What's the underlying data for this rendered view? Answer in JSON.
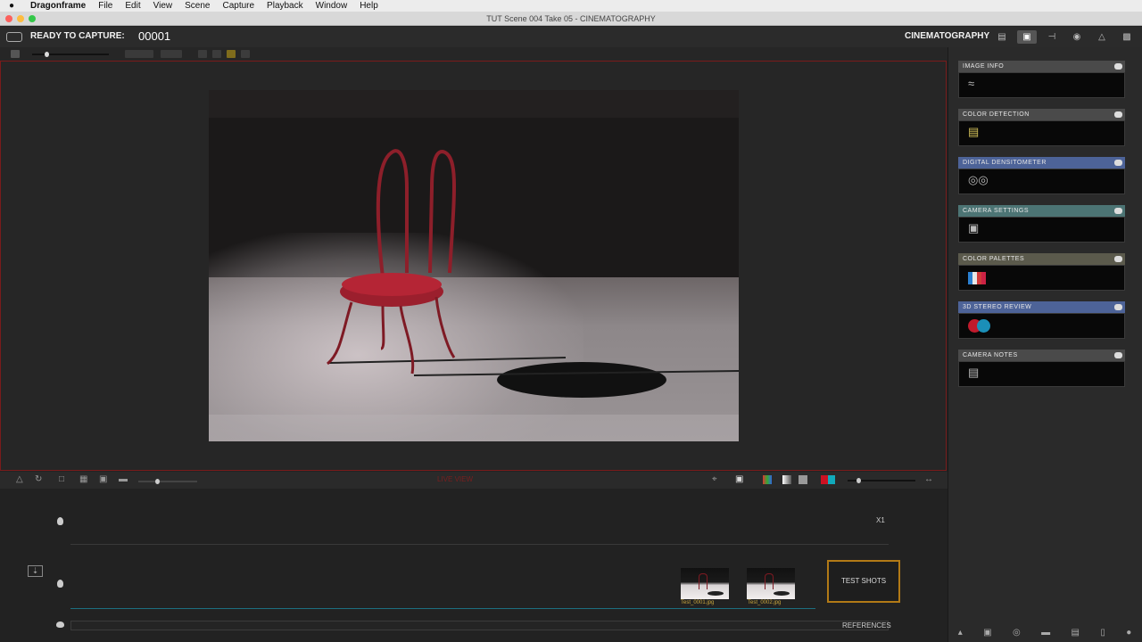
{
  "menubar": {
    "app": "Dragonframe",
    "items": [
      "File",
      "Edit",
      "View",
      "Scene",
      "Capture",
      "Playback",
      "Window",
      "Help"
    ]
  },
  "window": {
    "title": "TUT  Scene 004  Take 05 - CINEMATOGRAPHY"
  },
  "status": {
    "ready": "READY TO CAPTURE:",
    "frame": "00001",
    "workspace": "CINEMATOGRAPHY"
  },
  "viewbar": {
    "mode": "LIVE VIEW"
  },
  "timeline": {
    "speed": "X1",
    "thumbs": [
      {
        "caption": "Test_0001.jpg"
      },
      {
        "caption": "Test_0002.jpg"
      }
    ],
    "test_shots": "TEST SHOTS",
    "references": "REFERENCES"
  },
  "widgets": [
    {
      "title": "IMAGE INFO",
      "color": "#4a4a4a",
      "icon": "histogram-icon"
    },
    {
      "title": "COLOR DETECTION",
      "color": "#4a4a4a",
      "icon": "hatch-icon"
    },
    {
      "title": "DIGITAL DENSITOMETER",
      "color": "#4d6398",
      "icon": "densitometer-icon"
    },
    {
      "title": "CAMERA SETTINGS",
      "color": "#4c7474",
      "icon": "camera-icon"
    },
    {
      "title": "COLOR PALETTES",
      "color": "#5b5a4c",
      "icon": "palette-icon"
    },
    {
      "title": "3D STEREO REVIEW",
      "color": "#4d6398",
      "icon": "stereo-icon"
    },
    {
      "title": "CAMERA NOTES",
      "color": "#4a4a4a",
      "icon": "notes-icon"
    }
  ]
}
